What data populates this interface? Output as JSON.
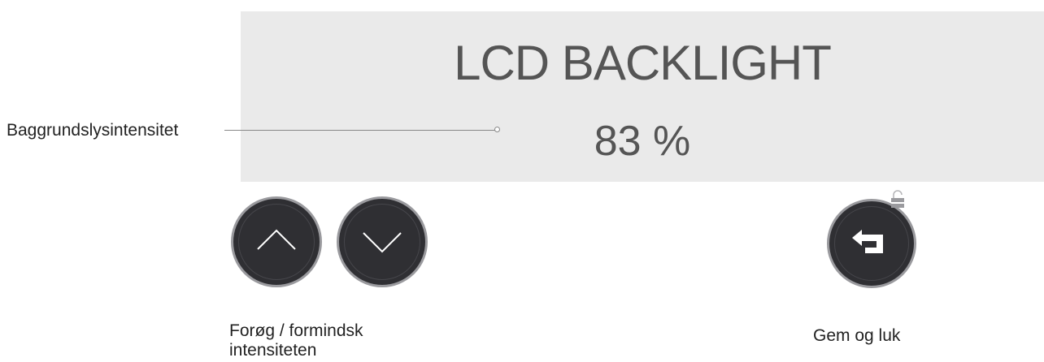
{
  "screen": {
    "title": "LCD BACKLIGHT",
    "value": "83 %"
  },
  "callout": {
    "label": "Baggrundslysintensitet"
  },
  "buttons": {
    "up_icon": "chevron-up-icon",
    "down_icon": "chevron-down-icon",
    "back_icon": "return-arrow-icon",
    "lock_icon": "lock-icon"
  },
  "captions": {
    "adjust": "Forøg / formindsk intensiteten",
    "save": "Gem og luk"
  },
  "colors": {
    "screen_bg": "#eaeaea",
    "button_bg": "#2f2f33",
    "button_ring": "#9a9a9e",
    "text": "#555555"
  }
}
